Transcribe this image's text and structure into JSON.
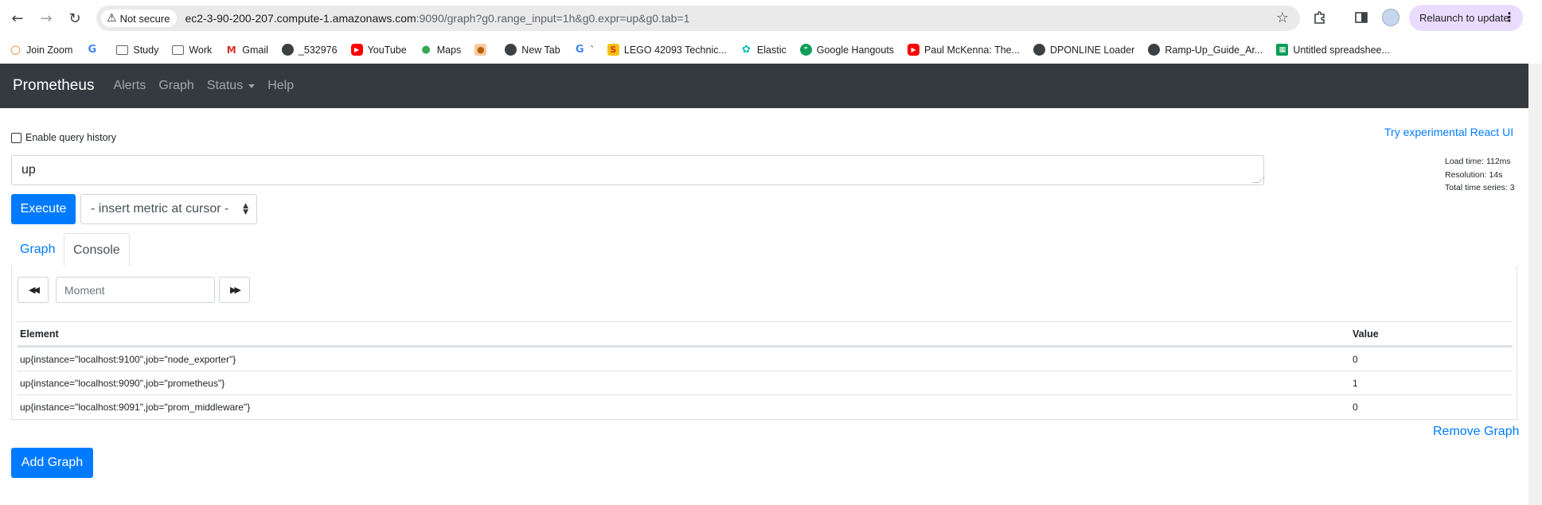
{
  "browser": {
    "security_label": "Not secure",
    "url_host": "ec2-3-90-200-207.compute-1.amazonaws.com",
    "url_rest": ":9090/graph?g0.range_input=1h&g0.expr=up&g0.tab=1",
    "relaunch_label": "Relaunch to update"
  },
  "bookmarks": [
    {
      "label": "Join Zoom",
      "icon": "zoom-icon"
    },
    {
      "label": "",
      "icon": "google-icon"
    },
    {
      "label": "Study",
      "icon": "folder-icon"
    },
    {
      "label": "Work",
      "icon": "folder-icon"
    },
    {
      "label": "Gmail",
      "icon": "gmail-icon"
    },
    {
      "label": "_532976",
      "icon": "globe-icon"
    },
    {
      "label": "YouTube",
      "icon": "youtube-icon"
    },
    {
      "label": "Maps",
      "icon": "maps-icon"
    },
    {
      "label": "",
      "icon": "toy-icon"
    },
    {
      "label": "New Tab",
      "icon": "globe-icon"
    },
    {
      "label": "`",
      "icon": "google-icon"
    },
    {
      "label": "LEGO 42093 Technic...",
      "icon": "lego-icon"
    },
    {
      "label": "Elastic",
      "icon": "elastic-icon"
    },
    {
      "label": "Google Hangouts",
      "icon": "hangouts-icon"
    },
    {
      "label": "Paul McKenna: The...",
      "icon": "youtube-icon"
    },
    {
      "label": "DPONLINE Loader",
      "icon": "globe-icon"
    },
    {
      "label": "Ramp-Up_Guide_Ar...",
      "icon": "globe-icon"
    },
    {
      "label": "Untitled spreadshee...",
      "icon": "sheets-icon"
    }
  ],
  "navbar": {
    "brand": "Prometheus",
    "links": [
      "Alerts",
      "Graph",
      "Status",
      "Help"
    ]
  },
  "query": {
    "history_label": "Enable query history",
    "react_link": "Try experimental React UI",
    "expression": "up",
    "execute_label": "Execute",
    "metric_select": "- insert metric at cursor -",
    "stats": [
      "Load time: 112ms",
      "Resolution: 14s",
      "Total time series: 3"
    ]
  },
  "tabs": [
    "Graph",
    "Console"
  ],
  "console": {
    "moment_placeholder": "Moment",
    "columns": [
      "Element",
      "Value"
    ],
    "rows": [
      {
        "element": "up{instance=\"localhost:9100\",job=\"node_exporter\"}",
        "value": "0"
      },
      {
        "element": "up{instance=\"localhost:9090\",job=\"prometheus\"}",
        "value": "1"
      },
      {
        "element": "up{instance=\"localhost:9091\",job=\"prom_middleware\"}",
        "value": "0"
      }
    ]
  },
  "actions": {
    "remove_graph": "Remove Graph",
    "add_graph": "Add Graph"
  },
  "colors": {
    "accent": "#007bff",
    "navbar": "#343a40",
    "relaunch": "#eadcff"
  }
}
